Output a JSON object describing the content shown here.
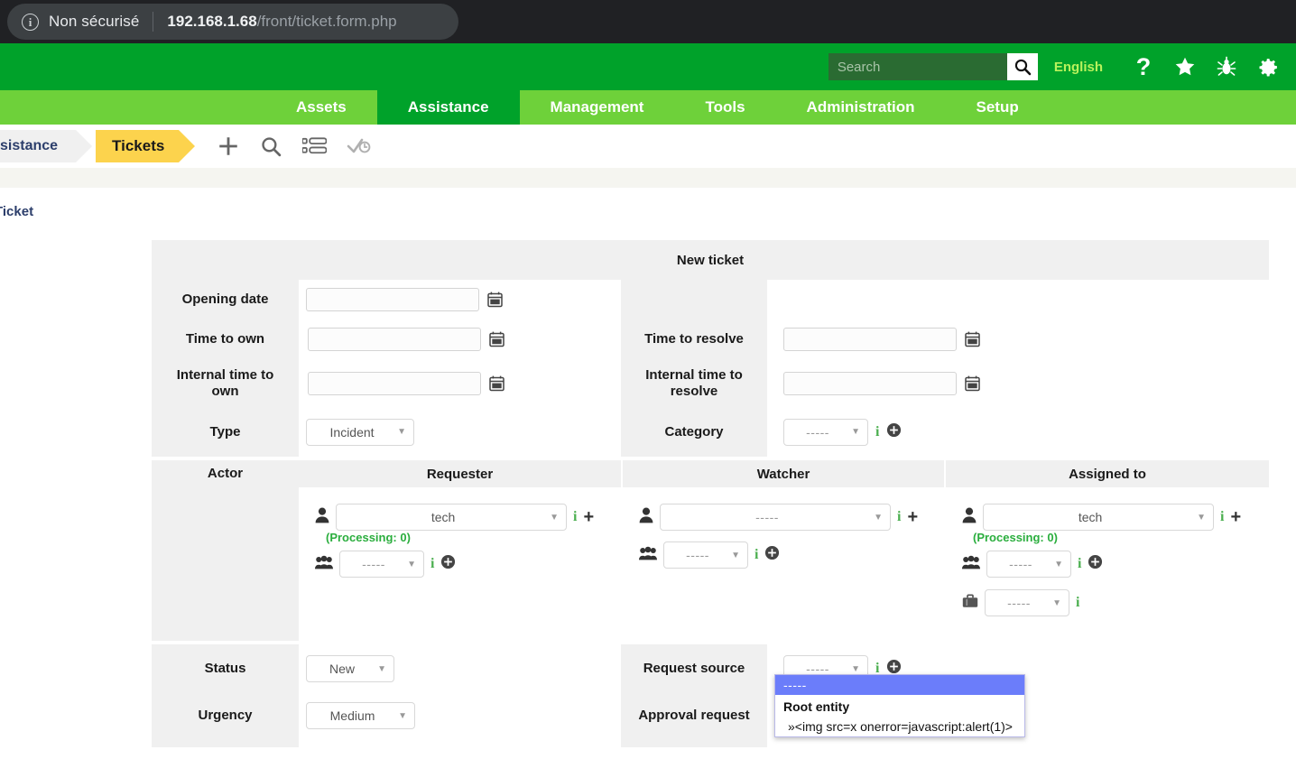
{
  "browser": {
    "security_label": "Non sécurisé",
    "url_host": "192.168.1.68",
    "url_path": "/front/ticket.form.php"
  },
  "topbar": {
    "search_placeholder": "Search",
    "search_value": "",
    "language": "English",
    "icons": [
      "help-icon",
      "star-icon",
      "bug-icon",
      "gear-icon"
    ]
  },
  "menu": [
    {
      "label": "Assets",
      "active": false
    },
    {
      "label": "Assistance",
      "active": true
    },
    {
      "label": "Management",
      "active": false
    },
    {
      "label": "Tools",
      "active": false
    },
    {
      "label": "Administration",
      "active": false
    },
    {
      "label": "Setup",
      "active": false
    }
  ],
  "breadcrumb": {
    "previous": "sistance",
    "current": "Tickets",
    "actions": [
      "add-icon",
      "search-icon",
      "list-icon",
      "validation-icon"
    ]
  },
  "page_title": "Ticket",
  "form": {
    "header": "New ticket",
    "rows": {
      "opening_date": {
        "label": "Opening date",
        "value": ""
      },
      "time_to_own": {
        "label": "Time to own",
        "value": ""
      },
      "internal_time_to_own": {
        "label": "Internal time to own",
        "value": ""
      },
      "type": {
        "label": "Type",
        "value": "Incident"
      },
      "time_to_resolve": {
        "label": "Time to resolve",
        "value": ""
      },
      "internal_time_to_resolve": {
        "label": "Internal time to resolve",
        "value": ""
      },
      "category": {
        "label": "Category",
        "value": "-----"
      }
    },
    "actor": {
      "label": "Actor",
      "columns": [
        {
          "title": "Requester",
          "user": "tech",
          "processing": "(Processing: 0)",
          "group": "-----"
        },
        {
          "title": "Watcher",
          "user": "-----",
          "processing": "",
          "group": "-----"
        },
        {
          "title": "Assigned to",
          "user": "tech",
          "processing": "(Processing: 0)",
          "group": "-----",
          "supplier": "-----"
        }
      ]
    },
    "bottom": {
      "status": {
        "label": "Status",
        "value": "New"
      },
      "urgency": {
        "label": "Urgency",
        "value": "Medium"
      },
      "request_source": {
        "label": "Request source",
        "value": "-----"
      },
      "approval_request": {
        "label": "Approval request"
      }
    },
    "dropdown": {
      "options": [
        {
          "text": "-----",
          "highlighted": true,
          "group": false
        },
        {
          "text": "Root entity",
          "highlighted": false,
          "group": true
        },
        {
          "text": "»<img src=x onerror=javascript:alert(1)>",
          "highlighted": false,
          "group": false
        }
      ]
    }
  },
  "colors": {
    "header_green": "#00a22a",
    "menu_green": "#6ed13a",
    "crumb_yellow": "#fcd34d",
    "accent_info": "#4caf50",
    "dropdown_highlight": "#6b7dfa",
    "label_bg": "#f0f0f0"
  }
}
